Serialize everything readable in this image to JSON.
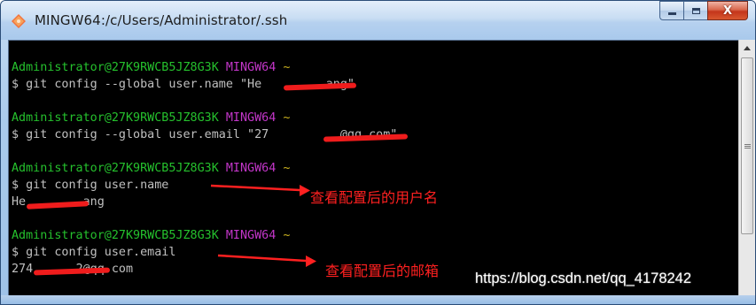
{
  "window": {
    "title": "MINGW64:/c/Users/Administrator/.ssh",
    "controls": {
      "minimize_icon": "minimize-icon",
      "maximize_icon": "maximize-icon",
      "close_glyph": "X"
    }
  },
  "terminal": {
    "user_host": "Administrator@27K9RWCB5JZ8G3K",
    "shell_name": "MINGW64",
    "path": "~",
    "prompt_symbol": "$",
    "blocks": [
      {
        "command": "git config --global user.name \"He",
        "command_tail": "ang\""
      },
      {
        "command": "git config --global user.email \"27",
        "command_tail": "@qq.com\""
      },
      {
        "command": "git config user.name",
        "output": "He",
        "output_tail": "ang"
      },
      {
        "command": "git config user.email",
        "output": "274",
        "output_tail": "2@qq.com"
      }
    ]
  },
  "annotations": {
    "username_note": "查看配置后的用户名",
    "email_note": "查看配置后的邮箱"
  },
  "watermark": "https://blog.csdn.net/qq_4178242",
  "colors": {
    "user_host": "#25c12d",
    "shell_name": "#c336c9",
    "path": "#cdb41f",
    "text": "#c0c0c0",
    "annotation_red": "#ff2020"
  }
}
